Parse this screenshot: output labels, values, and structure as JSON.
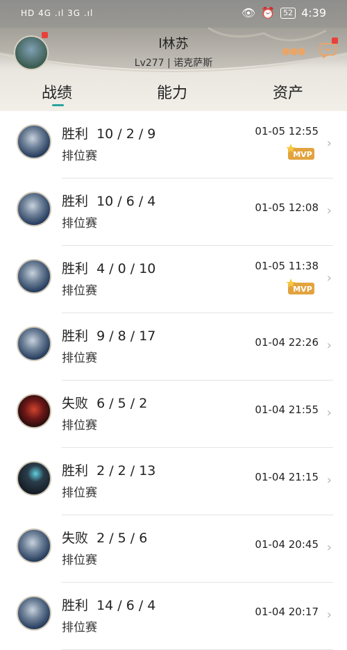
{
  "status_bar": {
    "left": "HD 4G .ıl 3G .ıl",
    "battery": "52",
    "time": "4:39"
  },
  "profile": {
    "name": "l林苏",
    "subtitle": "Lv277 | 诺克萨斯"
  },
  "tabs": [
    {
      "label": "战绩"
    },
    {
      "label": "能力"
    },
    {
      "label": "资产"
    }
  ],
  "active_tab": 0,
  "mvp_label": "MVP",
  "matches": [
    {
      "result": "胜利  10 / 2 / 9",
      "mode": "排位赛",
      "time": "01-05 12:55",
      "mvp": true,
      "champ": "pale"
    },
    {
      "result": "胜利  10 / 6 / 4",
      "mode": "排位赛",
      "time": "01-05 12:08",
      "mvp": false,
      "champ": "pale"
    },
    {
      "result": "胜利  4 / 0 / 10",
      "mode": "排位赛",
      "time": "01-05 11:38",
      "mvp": true,
      "champ": "pale"
    },
    {
      "result": "胜利  9 / 8 / 17",
      "mode": "排位赛",
      "time": "01-04 22:26",
      "mvp": false,
      "champ": "pale"
    },
    {
      "result": "失败  6 / 5 / 2",
      "mode": "排位赛",
      "time": "01-04 21:55",
      "mvp": false,
      "champ": "red"
    },
    {
      "result": "胜利  2 / 2 / 13",
      "mode": "排位赛",
      "time": "01-04 21:15",
      "mvp": false,
      "champ": "dark"
    },
    {
      "result": "失败  2 / 5 / 6",
      "mode": "排位赛",
      "time": "01-04 20:45",
      "mvp": false,
      "champ": "pale"
    },
    {
      "result": "胜利  14 / 6 / 4",
      "mode": "排位赛",
      "time": "01-04 20:17",
      "mvp": false,
      "champ": "pale"
    }
  ],
  "colors": {
    "accent": "#2aa4a0",
    "badge": "#e8413a",
    "mvp": "#e2a33e"
  }
}
